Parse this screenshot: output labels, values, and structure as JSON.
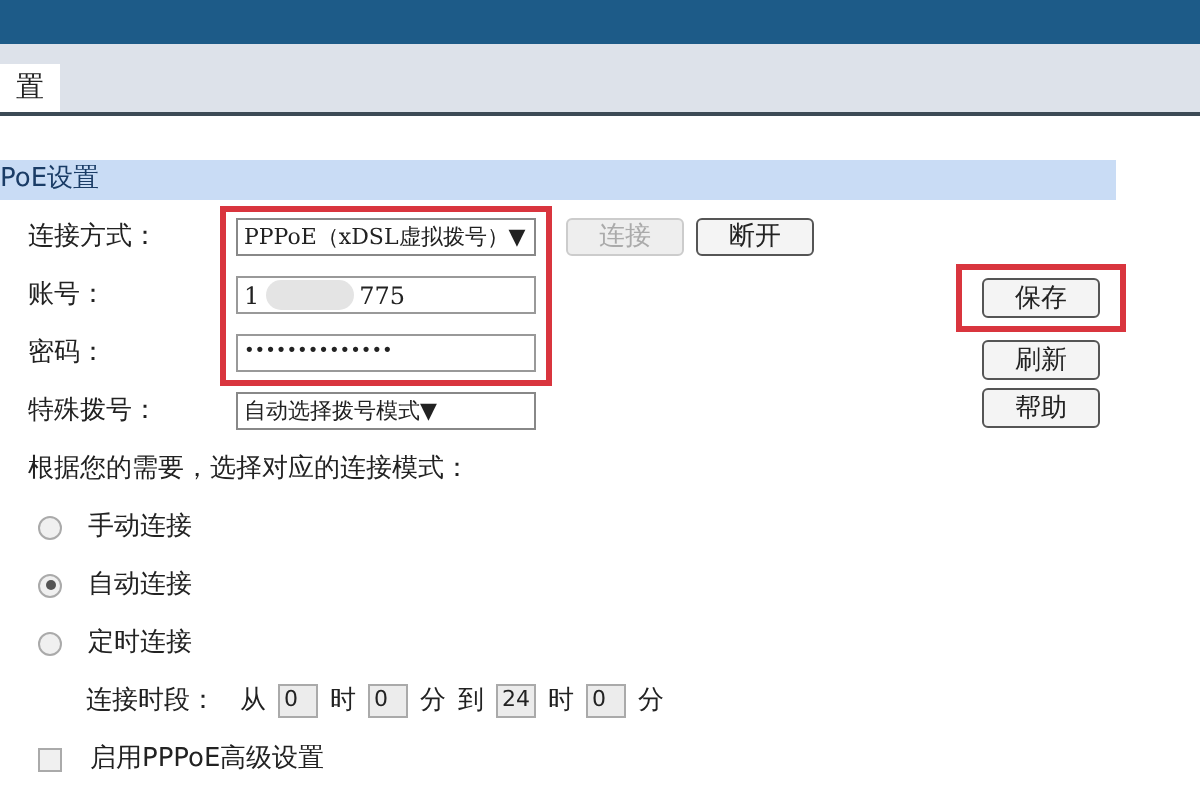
{
  "tab": {
    "label": "置",
    "selected": true
  },
  "section": {
    "title": "PoE设置"
  },
  "fields_highlighted": true,
  "connection_type": {
    "label": "连接方式：",
    "value": "PPPoE（xDSL虚拟拨号）",
    "arrow": "▼"
  },
  "connection_buttons": [
    {
      "label": "连接",
      "disabled": true
    },
    {
      "label": "断开",
      "disabled": false
    }
  ],
  "account": {
    "label": "账号：",
    "value_start": "1",
    "value_end": "775",
    "redacted": true
  },
  "password": {
    "label": "密码：",
    "value": "••••••••••••••"
  },
  "special_dial": {
    "label": "特殊拨号：",
    "value": "自动选择拨号模式",
    "arrow": "▼"
  },
  "mode_prompt": "根据您的需要，选择对应的连接模式：",
  "modes": [
    {
      "label": "手动连接",
      "selected": false
    },
    {
      "label": "自动连接",
      "selected": true
    },
    {
      "label": "定时连接",
      "selected": false
    }
  ],
  "schedule": {
    "label": "连接时段：",
    "from": "从",
    "to": "到",
    "parts": [
      {
        "value": "0",
        "unit": "时"
      },
      {
        "value": "0",
        "unit": "分"
      },
      {
        "value": "24",
        "unit": "时"
      },
      {
        "value": "0",
        "unit": "分"
      }
    ]
  },
  "advanced": {
    "label": "启用PPPoE高级设置",
    "checked": false
  },
  "side_buttons": [
    {
      "label": "保存",
      "highlighted": true
    },
    {
      "label": "刷新"
    },
    {
      "label": "帮助"
    }
  ]
}
